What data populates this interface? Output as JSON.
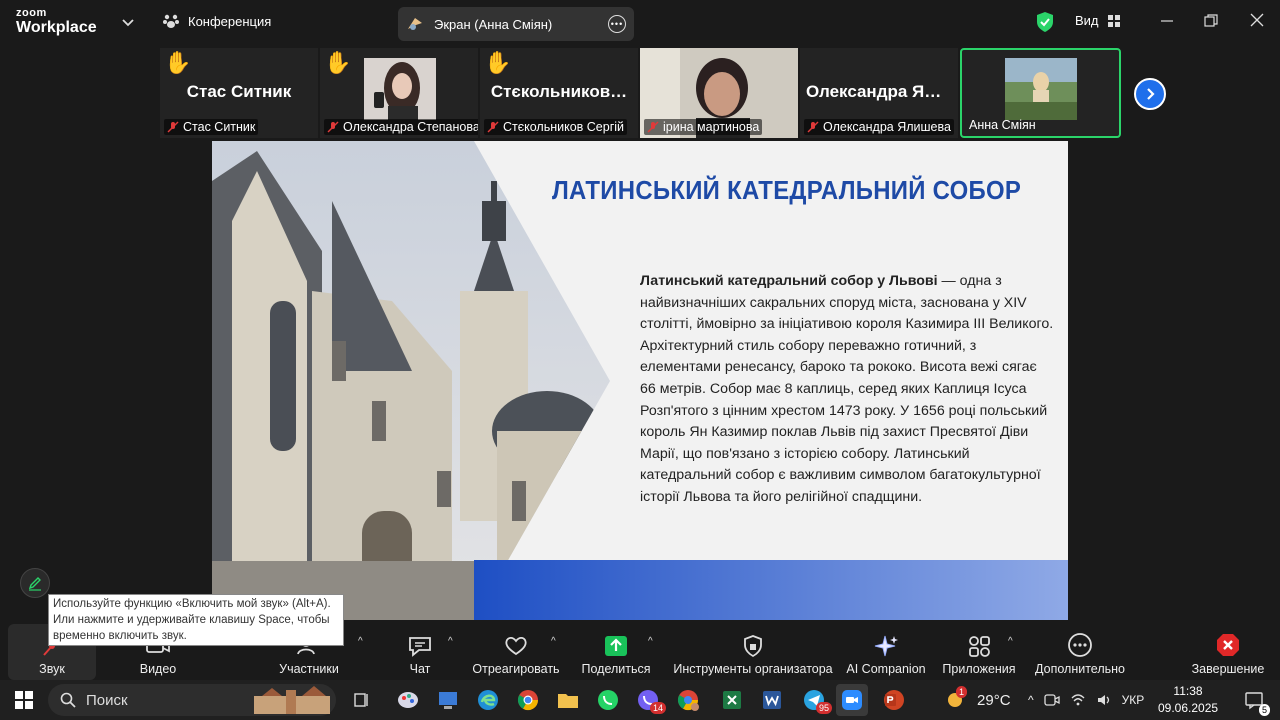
{
  "app": {
    "logo_top": "zoom",
    "logo_bottom": "Workplace",
    "conference_label": "Конференция",
    "screen_share_label": "Экран (Анна Сміян)",
    "view_label": "Вид"
  },
  "participants": [
    {
      "big_name": "Стас Ситник",
      "label": "Стас Ситник",
      "hand": true
    },
    {
      "big_name": "",
      "label": "Олександра Степанова",
      "hand": true
    },
    {
      "big_name": "Стєкольников…",
      "label": "Стєкольников Сергій",
      "hand": true
    },
    {
      "big_name": "",
      "label": "ірина мартинова",
      "hand": false
    },
    {
      "big_name": "Олександра Ял…",
      "label": "Олександра Ялишева",
      "hand": false
    },
    {
      "big_name": "",
      "label": "Анна Сміян",
      "hand": false
    }
  ],
  "slide": {
    "title": "ЛАТИНСЬКИЙ КАТЕДРАЛЬНИЙ СОБОР",
    "lead_bold": "Латинський катедральний собор у Львові",
    "body": " — одна з найвизначніших сакральних споруд міста, заснована у XIV столітті, ймовірно за ініціативою короля Казимира III Великого. Архітектурний стиль собору переважно готичний, з елементами ренесансу, бароко та рококо. Висота вежі сягає 66 метрів. Собор має 8 каплиць, серед яких Каплиця Ісуса Розп'ятого з цінним хрестом 1473 року. У 1656 році польський король Ян Казимир поклав Львів під захист Пресвятої Діви Марії, що пов'язано з історією собору. Латинський катедральний собор є важливим символом багатокультурної історії Львова та його релігійної спадщини."
  },
  "tooltip": {
    "line1": "Используйте функцию «Включить мой звук» (Alt+A).",
    "line2": "Или нажмите и удерживайте клавишу Space, чтобы",
    "line3": "временно включить звук."
  },
  "toolbar": {
    "audio": "Звук",
    "video": "Видео",
    "participants": "Участники",
    "chat": "Чат",
    "react": "Отреагировать",
    "share": "Поделиться",
    "host_tools": "Инструменты организатора",
    "ai": "AI Companion",
    "apps": "Приложения",
    "more": "Дополнительно",
    "end": "Завершение"
  },
  "taskbar": {
    "search_label": "Поиск",
    "weather_temp": "29°C",
    "weather_badge": "1",
    "lang": "УКР",
    "time": "11:38",
    "date": "09.06.2025",
    "notification_count": "5",
    "badges": {
      "viber": "14",
      "telegram": "95"
    }
  },
  "colors": {
    "accent_green": "#2bd46a",
    "slide_title": "#1e4aa6",
    "share_green": "#19c25a",
    "end_red": "#e02828"
  }
}
